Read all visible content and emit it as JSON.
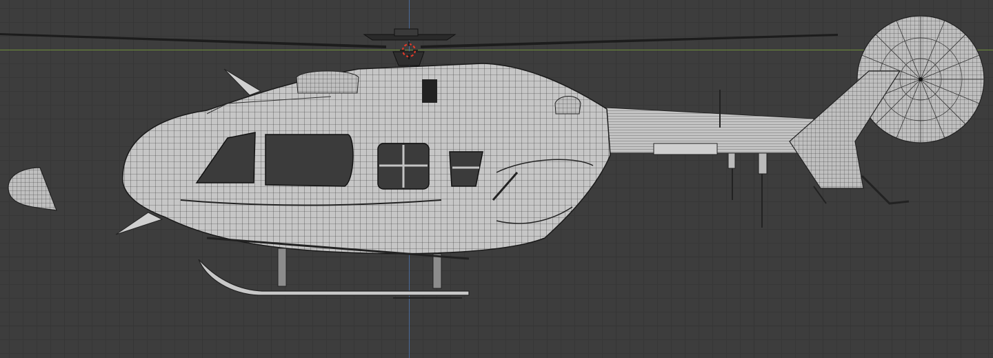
{
  "viewport": {
    "colors": {
      "background": "#3d3d3d",
      "grid_major": "#353535",
      "x_axis": "#6f8f3a",
      "z_axis": "#4a6a9a",
      "mesh_fill": "#c9c9c9",
      "wire": "#1e1e1e",
      "cursor_red": "#e03a2a"
    },
    "icons": [
      "3d-cursor-icon"
    ]
  }
}
